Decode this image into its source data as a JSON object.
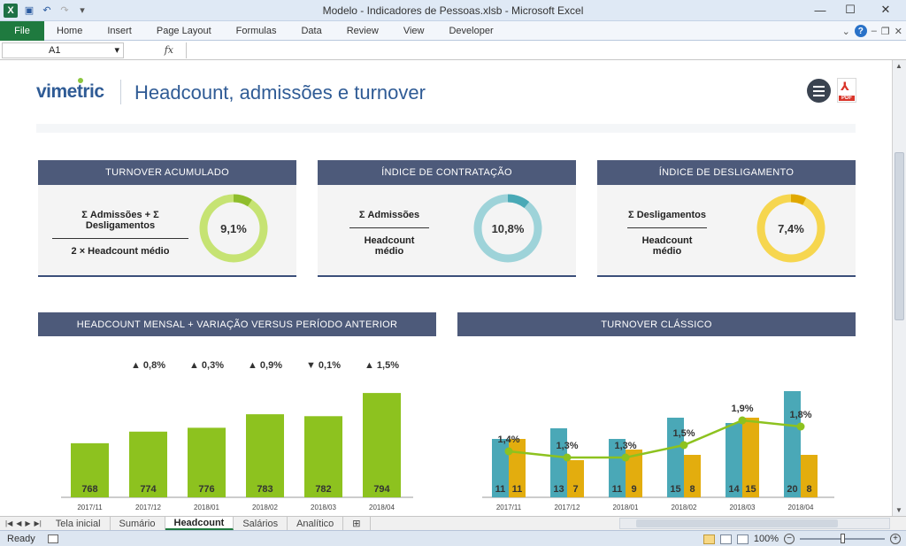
{
  "window": {
    "title": "Modelo - Indicadores de Pessoas.xlsb - Microsoft Excel",
    "minimize": "—",
    "maximize": "☐",
    "close": "✕"
  },
  "ribbon": {
    "file": "File",
    "tabs": [
      "Home",
      "Insert",
      "Page Layout",
      "Formulas",
      "Data",
      "Review",
      "View",
      "Developer"
    ]
  },
  "formula_bar": {
    "name_box": "A1",
    "fx": "fx",
    "content": ""
  },
  "dashboard": {
    "logo": "vimetric",
    "title": "Headcount, admissões e turnover"
  },
  "kpis": [
    {
      "title": "TURNOVER ACUMULADO",
      "numerator": "Σ Admissões  +  Σ Desligamentos",
      "denominator": "2 × Headcount médio",
      "value_label": "9,1%",
      "value": 0.091,
      "color_main": "#c6e373",
      "color_accent": "#8fbd2c"
    },
    {
      "title": "ÍNDICE DE CONTRATAÇÃO",
      "numerator": "Σ Admissões",
      "denominator": "Headcount médio",
      "value_label": "10,8%",
      "value": 0.108,
      "color_main": "#9ed3d9",
      "color_accent": "#49a9b6"
    },
    {
      "title": "ÍNDICE DE DESLIGAMENTO",
      "numerator": "Σ Desligamentos",
      "denominator": "Headcount médio",
      "value_label": "7,4%",
      "value": 0.074,
      "color_main": "#f6d64f",
      "color_accent": "#e0a800"
    }
  ],
  "chart_data": [
    {
      "type": "bar",
      "title": "HEADCOUNT MENSAL + VARIAÇÃO VERSUS PERÍODO ANTERIOR",
      "categories": [
        "2017/11",
        "2017/12",
        "2018/01",
        "2018/02",
        "2018/03",
        "2018/04"
      ],
      "values": [
        768,
        774,
        776,
        783,
        782,
        794
      ],
      "variation_labels": [
        "",
        "▲ 0,8%",
        "▲ 0,3%",
        "▲ 0,9%",
        "▼ 0,1%",
        "▲ 1,5%"
      ],
      "color": "#8dc21f"
    },
    {
      "type": "bar+line",
      "title": "TURNOVER CLÁSSICO",
      "categories": [
        "2017/11",
        "2017/12",
        "2018/01",
        "2018/02",
        "2018/03",
        "2018/04"
      ],
      "series": [
        {
          "values": [
            11,
            13,
            11,
            15,
            14,
            20
          ],
          "color": "#4aa8b7"
        },
        {
          "values": [
            11,
            7,
            9,
            8,
            15,
            8
          ],
          "color": "#e3ad0e"
        }
      ],
      "line": {
        "values": [
          1.4,
          1.3,
          1.3,
          1.5,
          1.9,
          1.8
        ],
        "labels": [
          "1,4%",
          "1,3%",
          "1,3%",
          "1,5%",
          "1,9%",
          "1,8%"
        ],
        "color": "#8dc21f"
      }
    }
  ],
  "sheet_tabs": [
    "Tela inicial",
    "Sumário",
    "Headcount",
    "Salários",
    "Analítico"
  ],
  "active_tab": "Headcount",
  "status": {
    "ready": "Ready",
    "zoom": "100%"
  }
}
